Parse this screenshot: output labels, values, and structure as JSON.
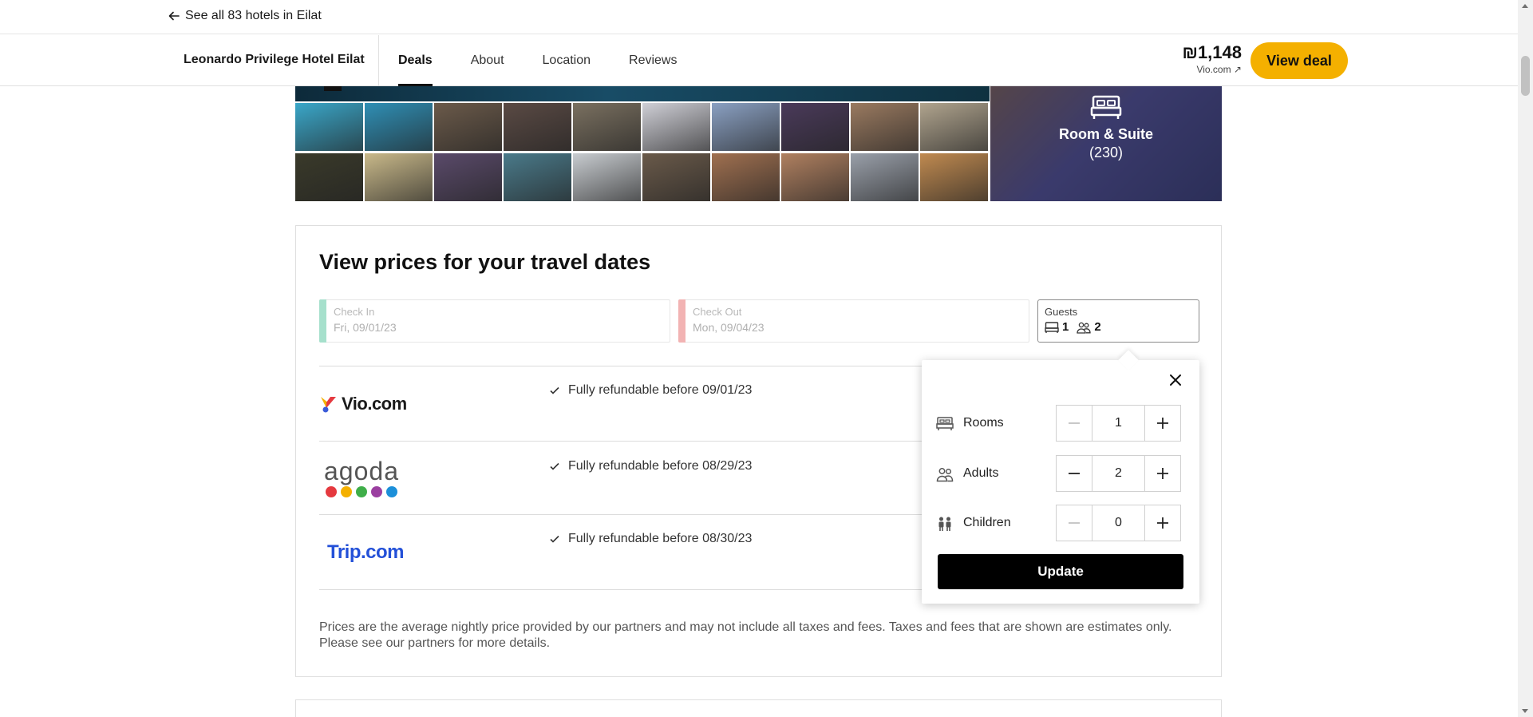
{
  "back_link": {
    "label": "See all 83 hotels in Eilat",
    "icon": "arrow-left-icon"
  },
  "nav": {
    "hotel_name": "Leonardo Privilege Hotel Eilat",
    "tabs": [
      {
        "label": "Deals",
        "active": true
      },
      {
        "label": "About",
        "active": false
      },
      {
        "label": "Location",
        "active": false
      },
      {
        "label": "Reviews",
        "active": false
      }
    ],
    "price": "₪1,148",
    "price_source": "Vio.com ↗",
    "view_deal_label": "View deal",
    "accent_color": "#f4b000"
  },
  "gallery": {
    "room_tile_label": "Room & Suite",
    "room_tile_count": "(230)",
    "thumbnail_colors": [
      "#3aa7c9",
      "#2f8fb5",
      "#6b5a4a",
      "#5a4a44",
      "#7a7060",
      "#cfcfd6",
      "#8aa0c2",
      "#4a3a5a",
      "#9a7a60",
      "#b0a48e",
      "#3a3a2a",
      "#c9b98a",
      "#5a4a6a",
      "#4a7a8a",
      "#c8ccd0",
      "#6a5a4a",
      "#a07050",
      "#b08060",
      "#9aa0aa",
      "#c08a50"
    ]
  },
  "prices_section": {
    "title": "View prices for your travel dates",
    "check_in": {
      "label": "Check In",
      "value": "Fri, 09/01/23",
      "color": "#a6e0cc"
    },
    "check_out": {
      "label": "Check Out",
      "value": "Mon, 09/04/23",
      "color": "#f2b3b3"
    },
    "guests": {
      "label": "Guests",
      "rooms": "1",
      "adults": "2"
    },
    "deals": [
      {
        "provider": "Vio.com",
        "refund": "Fully refundable before 09/01/23"
      },
      {
        "provider": "agoda",
        "refund": "Fully refundable before 08/29/23"
      },
      {
        "provider": "Trip.com",
        "refund": "Fully refundable before 08/30/23"
      }
    ],
    "disclaimer": "Prices are the average nightly price provided by our partners and may not include all taxes and fees. Taxes and fees that are shown are estimates only. Please see our partners for more details."
  },
  "guests_popover": {
    "rows": [
      {
        "label": "Rooms",
        "value": "1",
        "icon": "bed-icon"
      },
      {
        "label": "Adults",
        "value": "2",
        "icon": "adults-icon"
      },
      {
        "label": "Children",
        "value": "0",
        "icon": "children-icon"
      }
    ],
    "update_label": "Update"
  },
  "agoda_dot_colors": [
    "#e5393f",
    "#f4b000",
    "#3fae49",
    "#9b3fa0",
    "#1c8fd9"
  ]
}
